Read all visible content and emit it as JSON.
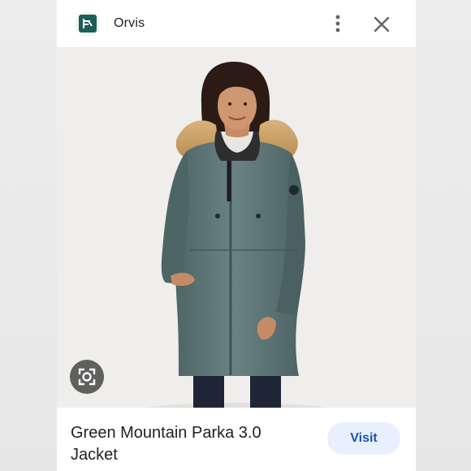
{
  "header": {
    "site_name": "Orvis",
    "favicon": "orvis-logo-icon",
    "more_icon": "more-vert-icon",
    "close_icon": "close-icon"
  },
  "image": {
    "subject": "woman wearing long green-gray parka with fur-trimmed hood",
    "lens_icon": "lens-search-icon"
  },
  "footer": {
    "title": "Green Mountain Parka 3.0 Jacket",
    "visit_label": "Visit"
  },
  "colors": {
    "brand_favicon": "#1b5f57",
    "visit_bg": "#e8f0fe",
    "visit_text": "#1a56b8",
    "parka": "#5f7778"
  }
}
